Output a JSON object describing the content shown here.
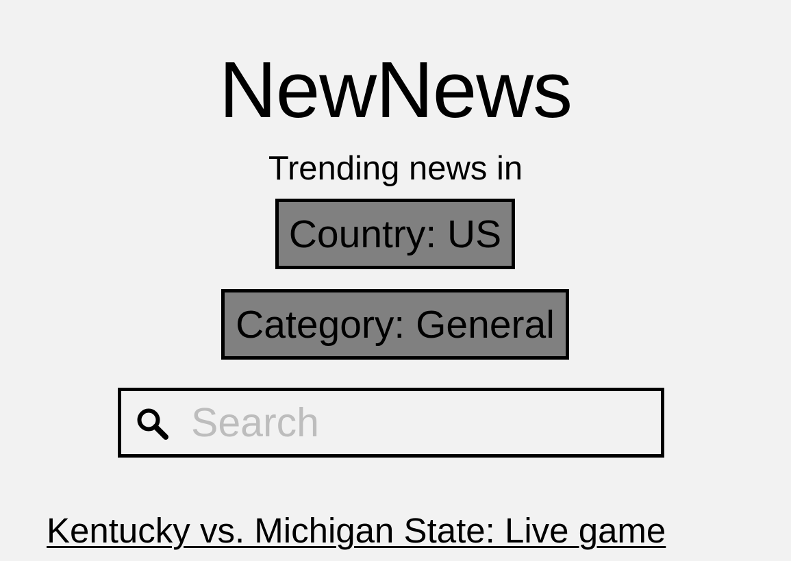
{
  "header": {
    "title": "NewNews",
    "subtitle": "Trending news in"
  },
  "filters": {
    "country_label": "Country: US",
    "category_label": "Category: General"
  },
  "search": {
    "icon": "search-icon",
    "placeholder": "Search",
    "value": ""
  },
  "articles": [
    {
      "title": "Kentucky vs. Michigan State: Live game"
    }
  ],
  "colors": {
    "background": "#f2f2f2",
    "button_fill": "#808080",
    "border": "#000000",
    "placeholder": "#bdbdbd"
  }
}
